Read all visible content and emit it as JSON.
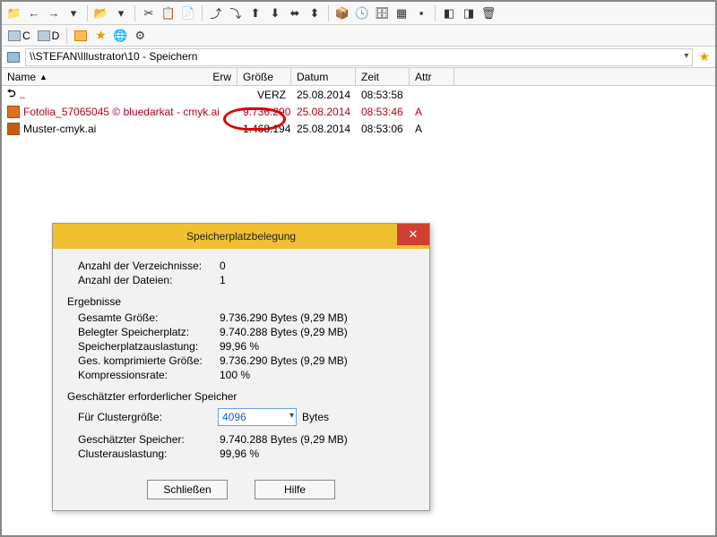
{
  "toolbar1_icons": [
    "📁",
    "←",
    "→",
    "▾",
    "│",
    "📂",
    "▾",
    "│",
    "✂",
    "📋",
    "📄",
    "│",
    "⤴",
    "⤵",
    "⬆",
    "⬇",
    "⬌",
    "⬍",
    "│",
    "📦",
    "🕓",
    "🗄",
    "▦",
    "▪",
    "│",
    "◧",
    "◨",
    "🗑"
  ],
  "toolbar2": {
    "drives": [
      {
        "icon": "drv",
        "label": "C"
      },
      {
        "icon": "drv",
        "label": "D"
      }
    ],
    "right_icons": [
      "home",
      "star",
      "🌐",
      "⚙"
    ]
  },
  "path": {
    "icon": "net",
    "text": "\\\\STEFAN\\Illustrator\\10 - Speichern"
  },
  "columns": {
    "name": "Name",
    "ext": "Erw",
    "size": "Größe",
    "date": "Datum",
    "time": "Zeit",
    "attr": "Attr"
  },
  "rows": [
    {
      "icon": "up",
      "name": "..",
      "size": "VERZ",
      "date": "25.08.2014",
      "time": "08:53:58",
      "attr": ""
    },
    {
      "icon": "ai",
      "name": "Fotolia_57065045 © bluedarkat - cmyk.ai",
      "size": "9.736.290",
      "date": "25.08.2014",
      "time": "08:53:46",
      "attr": "A",
      "highlight": true
    },
    {
      "icon": "ai2",
      "name": "Muster-cmyk.ai",
      "size": "1.468.194",
      "date": "25.08.2014",
      "time": "08:53:06",
      "attr": "A"
    }
  ],
  "dialog": {
    "title": "Speicherplatzbelegung",
    "dir_count_label": "Anzahl der Verzeichnisse:",
    "dir_count": "0",
    "file_count_label": "Anzahl der Dateien:",
    "file_count": "1",
    "results_hdr": "Ergebnisse",
    "total_size_label": "Gesamte Größe:",
    "total_size": "9.736.290 Bytes (9,29 MB)",
    "used_label": "Belegter Speicherplatz:",
    "used": "9.740.288 Bytes (9,29 MB)",
    "usage_label": "Speicherplatzauslastung:",
    "usage": "99,96 %",
    "compressed_label": "Ges. komprimierte Größe:",
    "compressed": "9.736.290 Bytes (9,29 MB)",
    "ratio_label": "Kompressionsrate:",
    "ratio": "100 %",
    "estimate_hdr": "Geschätzter erforderlicher Speicher",
    "cluster_label": "Für Clustergröße:",
    "cluster_value": "4096",
    "cluster_unit": "Bytes",
    "est_space_label": "Geschätzter Speicher:",
    "est_space": "9.740.288 Bytes (9,29 MB)",
    "cluster_usage_label": "Clusterauslastung:",
    "cluster_usage": "99,96 %",
    "btn_close": "Schließen",
    "btn_help": "Hilfe"
  }
}
